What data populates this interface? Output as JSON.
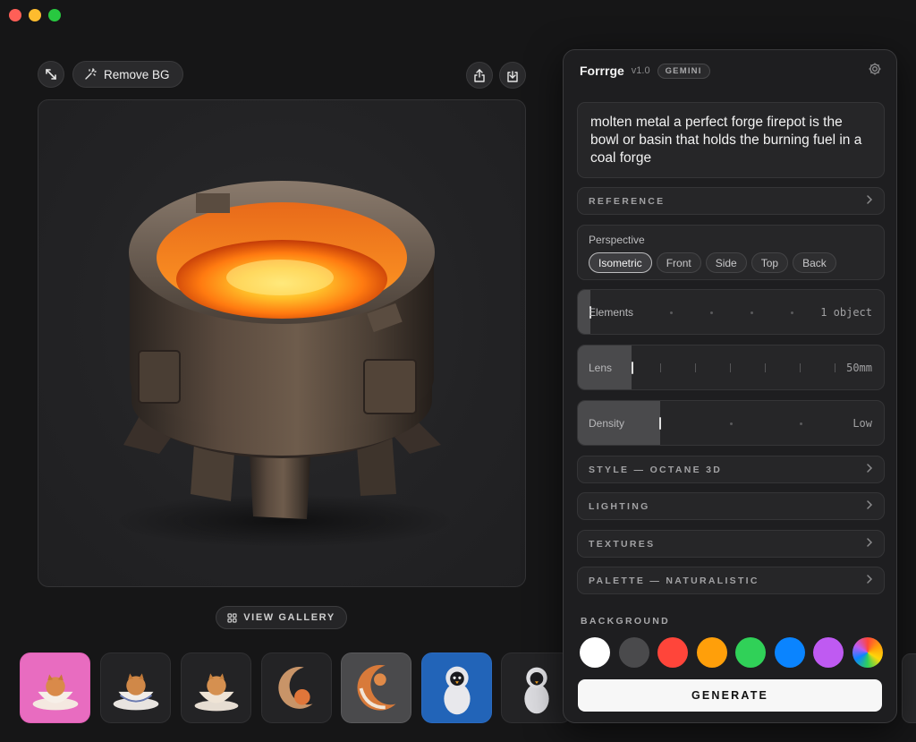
{
  "window": {
    "controls": [
      "close",
      "minimize",
      "zoom"
    ]
  },
  "toolbar": {
    "expand_icon": "expand-arrows-icon",
    "remove_bg_label": "Remove BG",
    "share_icon": "share-icon",
    "download_icon": "download-icon"
  },
  "canvas": {
    "subject": "forge firepot with molten metal"
  },
  "gallery": {
    "button_label": "VIEW GALLERY"
  },
  "thumbnails": [
    {
      "name": "kitten-in-teacup-pink",
      "selected": false
    },
    {
      "name": "kitten-in-teacup",
      "selected": false
    },
    {
      "name": "kitten-in-mug",
      "selected": false
    },
    {
      "name": "fox-on-moon",
      "selected": false
    },
    {
      "name": "fox-crescent",
      "selected": true
    },
    {
      "name": "penguin-astronaut-blue",
      "selected": false
    },
    {
      "name": "penguin-astronaut",
      "selected": false
    }
  ],
  "panel": {
    "app_name": "Forrrge",
    "version": "v1.0",
    "model_badge": "GEMINI",
    "prompt": "molten metal a perfect forge firepot is the bowl or basin that holds the burning fuel in a coal forge",
    "reference_label": "REFERENCE",
    "perspective": {
      "title": "Perspective",
      "options": [
        "Isometric",
        "Front",
        "Side",
        "Top",
        "Back"
      ],
      "selected": "Isometric"
    },
    "elements": {
      "label": "Elements",
      "value": "1 object",
      "level": 0.0
    },
    "lens": {
      "label": "Lens",
      "value": "50mm",
      "level": 0.17
    },
    "density": {
      "label": "Density",
      "value": "Low",
      "level": 0.27
    },
    "style_label": "STYLE — OCTANE 3D",
    "lighting_label": "LIGHTING",
    "textures_label": "TEXTURES",
    "palette_label": "PALETTE — NATURALISTIC",
    "background": {
      "label": "BACKGROUND",
      "colors": [
        "#ffffff",
        "#4a4a4c",
        "#ff453a",
        "#ff9f0a",
        "#30d158",
        "#0a84ff",
        "#bf5af2",
        "rainbow"
      ]
    },
    "generate_label": "GENERATE"
  }
}
